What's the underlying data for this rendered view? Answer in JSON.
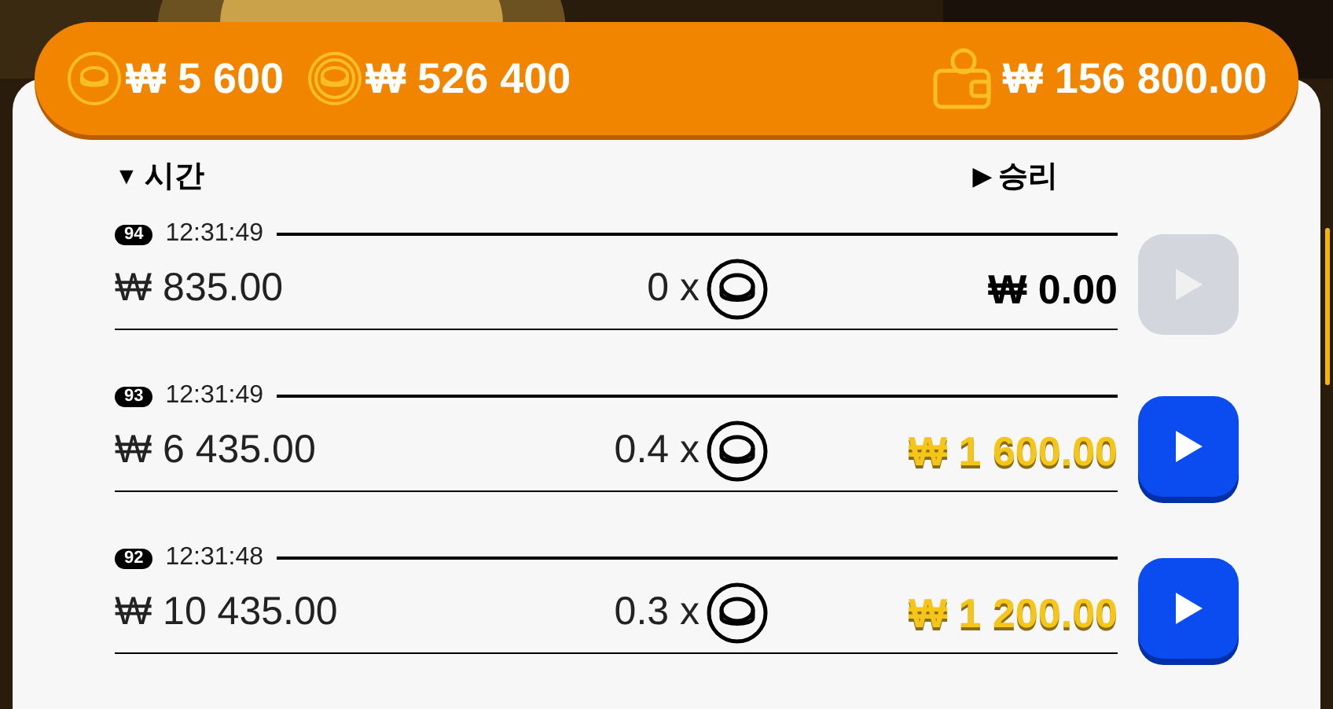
{
  "balances": [
    {
      "kind": "coin",
      "amount": "₩ 5 600"
    },
    {
      "kind": "coin-ring",
      "amount": "₩ 526 400"
    }
  ],
  "wallet": {
    "amount": "₩ 156 800.00"
  },
  "columns": [
    {
      "arrow": "▼",
      "label": "시간"
    },
    {
      "arrow": "▶",
      "label": "승리"
    }
  ],
  "rows": [
    {
      "number": "94",
      "time": "12:31:49",
      "bet": "₩ 835.00",
      "multiplier": "0 x",
      "win": "₩ 0.00",
      "kind": "zero",
      "disabled": true
    },
    {
      "number": "93",
      "time": "12:31:49",
      "bet": "₩ 6 435.00",
      "multiplier": "0.4 x",
      "win": "₩ 1 600.00",
      "kind": "win",
      "disabled": false
    },
    {
      "number": "92",
      "time": "12:31:48",
      "bet": "₩ 10 435.00",
      "multiplier": "0.3 x",
      "win": "₩ 1 200.00",
      "kind": "win",
      "disabled": false
    }
  ]
}
